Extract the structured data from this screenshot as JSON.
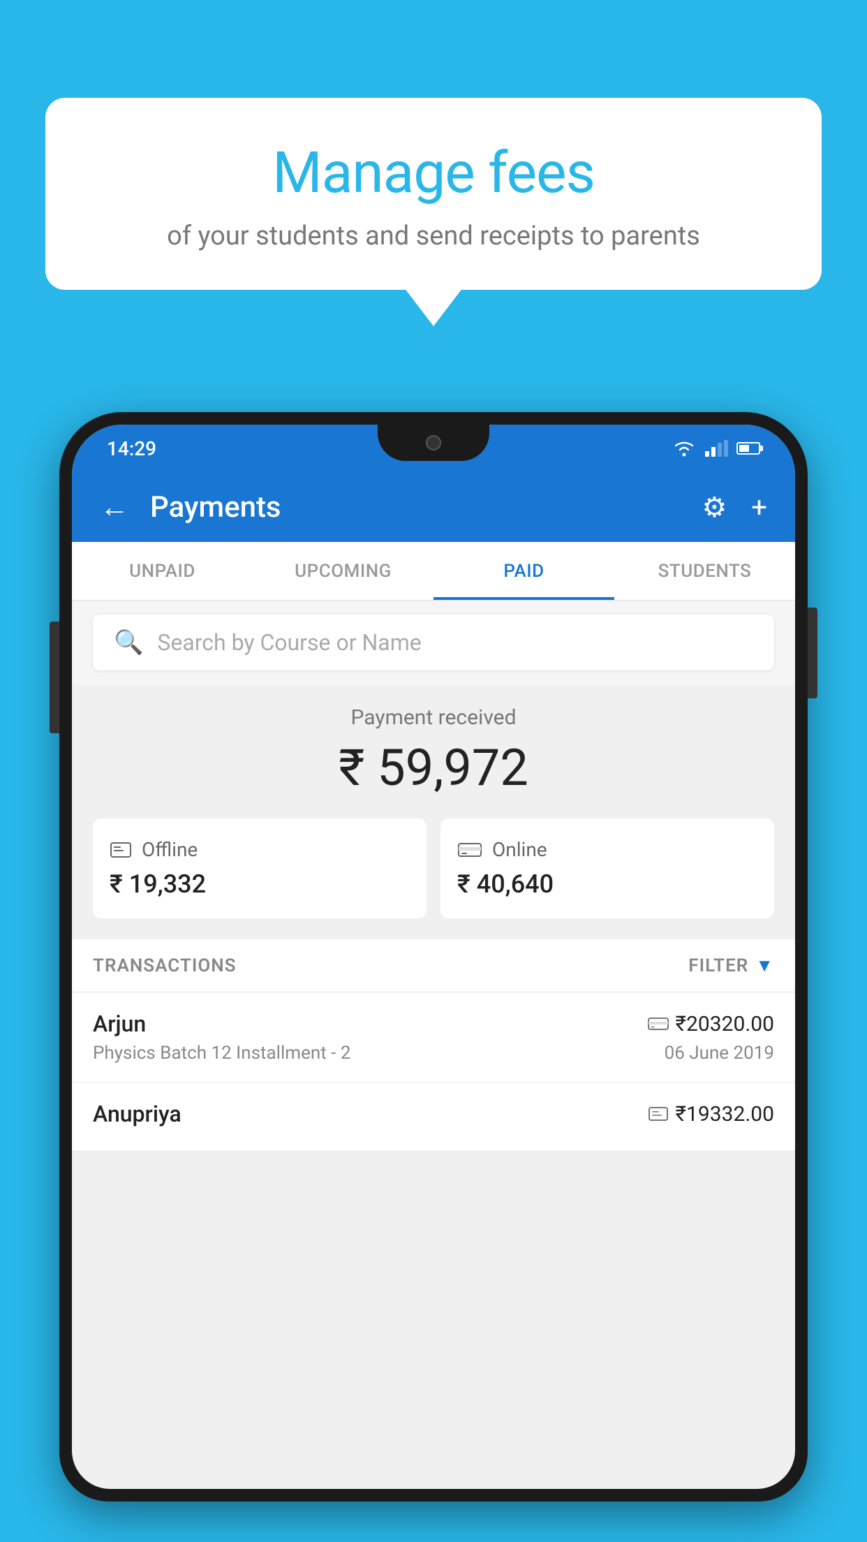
{
  "background_color": "#29b6e8",
  "bubble": {
    "title": "Manage fees",
    "subtitle": "of your students and send receipts to parents"
  },
  "status_bar": {
    "time": "14:29"
  },
  "header": {
    "title": "Payments",
    "back_label": "←",
    "settings_icon": "⚙",
    "add_icon": "+"
  },
  "tabs": [
    {
      "id": "unpaid",
      "label": "UNPAID",
      "active": false
    },
    {
      "id": "upcoming",
      "label": "UPCOMING",
      "active": false
    },
    {
      "id": "paid",
      "label": "PAID",
      "active": true
    },
    {
      "id": "students",
      "label": "STUDENTS",
      "active": false
    }
  ],
  "search": {
    "placeholder": "Search by Course or Name"
  },
  "payment_summary": {
    "label": "Payment received",
    "total": "₹ 59,972",
    "offline_label": "Offline",
    "offline_amount": "₹ 19,332",
    "online_label": "Online",
    "online_amount": "₹ 40,640"
  },
  "transactions_section": {
    "label": "TRANSACTIONS",
    "filter_label": "FILTER"
  },
  "transactions": [
    {
      "name": "Arjun",
      "course": "Physics Batch 12 Installment - 2",
      "amount": "₹20320.00",
      "date": "06 June 2019",
      "payment_type": "online"
    },
    {
      "name": "Anupriya",
      "course": "",
      "amount": "₹19332.00",
      "date": "",
      "payment_type": "offline"
    }
  ]
}
